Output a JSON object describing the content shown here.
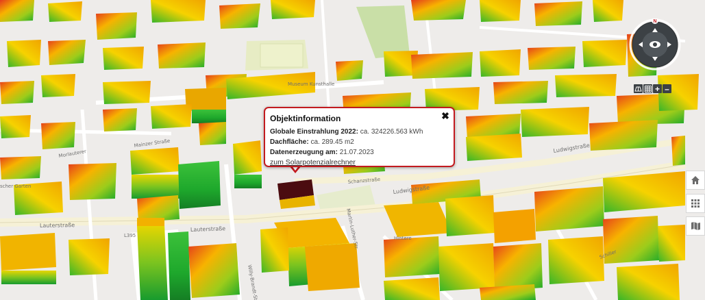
{
  "map": {
    "streets": {
      "lauterstrasse": "Lauterstraße",
      "ludwigstrasse": "Ludwigstraße",
      "schanzstrasse": "Schanzstraße",
      "martin_luther": "Martin-Luther-Str.",
      "morlauterer": "Morlauterer",
      "mainzer": "Mainzer Straße",
      "gasse": "Gasse",
      "kirch": "Kirchstr.",
      "willy": "Willy-Brandt-Straße",
      "schiller": "Schiller",
      "garten": "scher Garten",
      "road_label_1": "L395",
      "road_label_2": "L395",
      "museum": "Museum Kunsthalle",
      "hintere": "Hintere"
    }
  },
  "popup": {
    "title": "Objektinformation",
    "rows": [
      {
        "label": "Globale Einstrahlung 2022",
        "value": "ca. 324226.563 kWh"
      },
      {
        "label": "Dachfläche",
        "value": "ca. 289.45 m2"
      },
      {
        "label": "Datenerzeugung am",
        "value": "21.07.2023"
      }
    ],
    "link": "zum Solarpotenzialrechner",
    "close": "✖"
  },
  "controls": {
    "compass_north": "N",
    "zoom_plus": "+",
    "zoom_minus": "–"
  },
  "colors": {
    "popup_border": "#c31a1f",
    "roof_high": "#e0301e",
    "roof_mid": "#f5a300",
    "roof_low": "#1fb324",
    "compass": "#3c4145"
  }
}
